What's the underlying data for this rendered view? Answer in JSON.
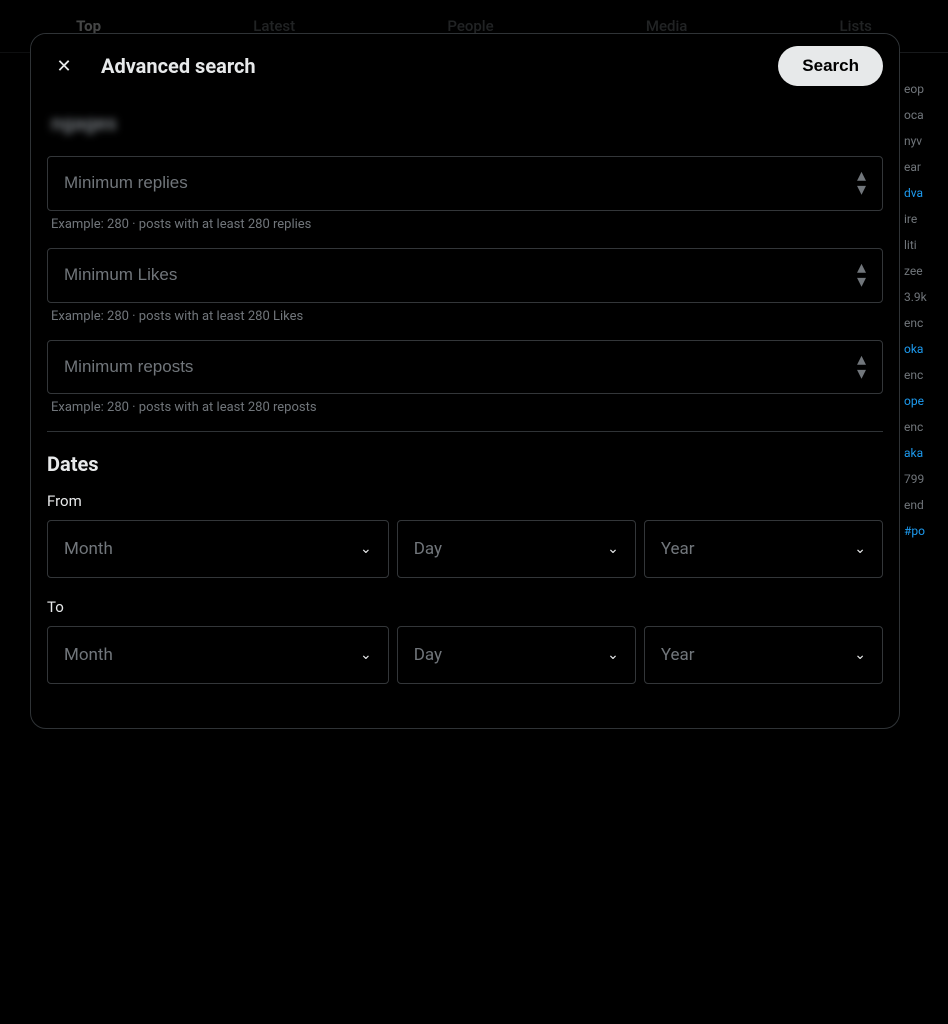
{
  "nav": {
    "tabs": [
      {
        "label": "Top",
        "active": true
      },
      {
        "label": "Latest",
        "active": false
      },
      {
        "label": "People",
        "active": false
      },
      {
        "label": "Media",
        "active": false
      },
      {
        "label": "Lists",
        "active": false
      }
    ]
  },
  "modal": {
    "title": "Advanced search",
    "close_label": "×",
    "search_button": "Search",
    "fields": {
      "min_replies": {
        "placeholder": "Minimum replies",
        "hint": "Example: 280 · posts with at least 280 replies"
      },
      "min_likes": {
        "placeholder": "Minimum Likes",
        "hint": "Example: 280 · posts with at least 280 Likes"
      },
      "min_reposts": {
        "placeholder": "Minimum reposts",
        "hint": "Example: 280 · posts with at least 280 reposts"
      }
    },
    "dates": {
      "section_title": "Dates",
      "from_label": "From",
      "to_label": "To",
      "from_month_placeholder": "Month",
      "from_day_placeholder": "Day",
      "from_year_placeholder": "Year",
      "to_month_placeholder": "Month",
      "to_day_placeholder": "Day",
      "to_year_placeholder": "Year"
    }
  },
  "side_hints": [
    {
      "text": "eop",
      "color": "gray"
    },
    {
      "text": "oca",
      "color": "gray"
    },
    {
      "text": "nyv",
      "color": "gray"
    },
    {
      "text": "ear",
      "color": "gray"
    },
    {
      "text": "dva",
      "color": "blue"
    },
    {
      "text": "ire",
      "color": "gray"
    },
    {
      "text": "liti",
      "color": "gray"
    },
    {
      "text": "zee",
      "color": "gray"
    },
    {
      "text": "3.9k",
      "color": "gray"
    },
    {
      "text": "enc",
      "color": "gray"
    },
    {
      "text": "oka",
      "color": "blue"
    },
    {
      "text": "enc",
      "color": "gray"
    },
    {
      "text": "ope",
      "color": "blue"
    },
    {
      "text": "enc",
      "color": "gray"
    },
    {
      "text": "aka",
      "color": "blue"
    },
    {
      "text": "799",
      "color": "gray"
    },
    {
      "text": "end",
      "color": "gray"
    },
    {
      "text": "#po",
      "color": "blue"
    }
  ]
}
